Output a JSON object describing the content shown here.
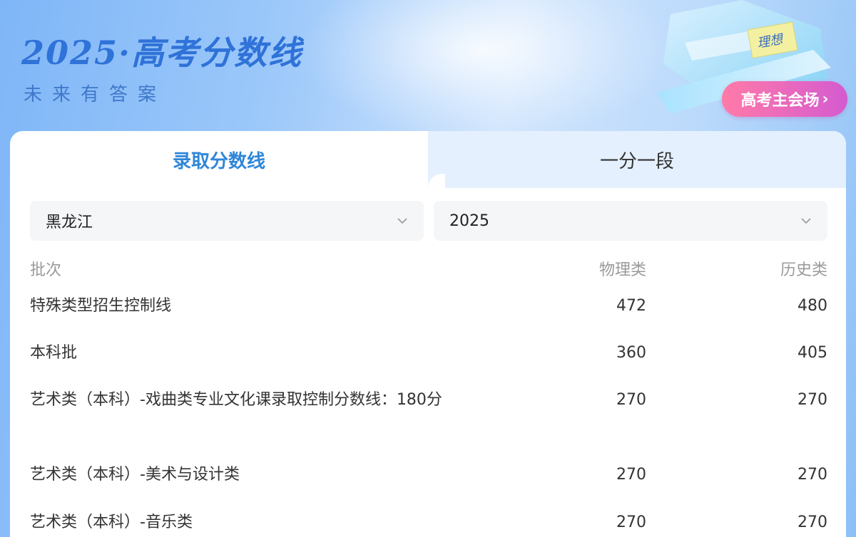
{
  "banner": {
    "title": "2025·高考分数线",
    "subtitle": "未来有答案",
    "book_badge": "理想",
    "cta_label": "高考主会场",
    "cta_chevron": "›"
  },
  "tabs": [
    {
      "label": "录取分数线",
      "active": true
    },
    {
      "label": "一分一段",
      "active": false
    }
  ],
  "filters": {
    "province": "黑龙江",
    "year": "2025"
  },
  "table": {
    "headers": {
      "batch": "批次",
      "physics": "物理类",
      "history": "历史类"
    },
    "rows": [
      {
        "batch": "特殊类型招生控制线",
        "physics": "472",
        "history": "480"
      },
      {
        "batch": "本科批",
        "physics": "360",
        "history": "405"
      },
      {
        "batch": "艺术类（本科）-戏曲类专业文化课录取控制分数线：180分",
        "physics": "270",
        "history": "270"
      },
      {
        "batch": "艺术类（本科）-美术与设计类",
        "physics": "270",
        "history": "270"
      },
      {
        "batch": "艺术类（本科）-音乐类",
        "physics": "270",
        "history": "270"
      }
    ]
  },
  "colors": {
    "accent": "#2f86d8",
    "cta_start": "#ff7aa8",
    "cta_end": "#d45bd0"
  }
}
